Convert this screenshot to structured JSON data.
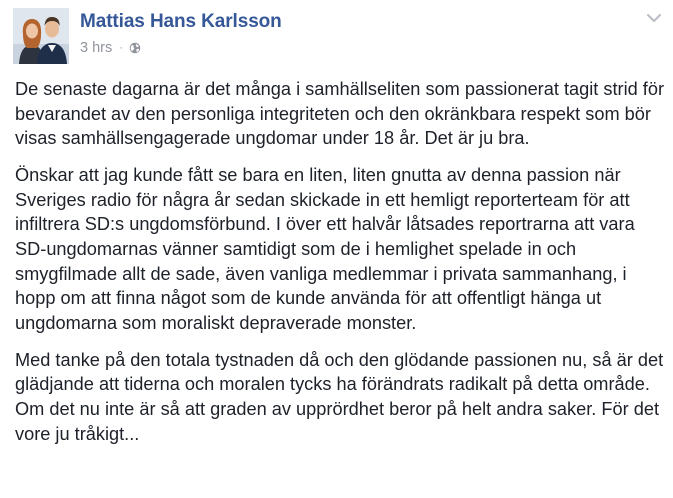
{
  "post": {
    "author": "Mattias Hans Karlsson",
    "timestamp": "3 hrs",
    "separator": "·",
    "privacy_icon": "globe-icon",
    "menu_icon": "chevron-down-icon",
    "paragraphs": [
      "De senaste dagarna är det många i samhällseliten som passionerat tagit strid för bevarandet av den personliga integriteten och den okränkbara respekt som bör visas samhällsengagerade ungdomar under 18 år. Det är ju bra.",
      "Önskar att jag kunde fått se bara en liten, liten gnutta av denna passion när Sveriges radio för några år sedan skickade in ett hemligt reporterteam för att infiltrera SD:s ungdomsförbund. I över ett halvår låtsades reportrarna att vara SD-ungdomarnas vänner samtidigt som de i hemlighet spelade in och smygfilmade allt de sade, även vanliga medlemmar i privata sammanhang, i hopp om att finna något som de kunde använda för att offentligt hänga ut ungdomarna som moraliskt depraverade monster.",
      "Med tanke på den totala tystnaden då och den glödande passionen nu, så är det glädjande att tiderna och moralen tycks ha förändrats radikalt på detta område. Om det nu inte är så att graden av upprördhet beror på helt andra saker. För det vore ju tråkigt..."
    ]
  },
  "colors": {
    "author_link": "#365899",
    "meta_text": "#90949c",
    "body_text": "#1d2129"
  }
}
